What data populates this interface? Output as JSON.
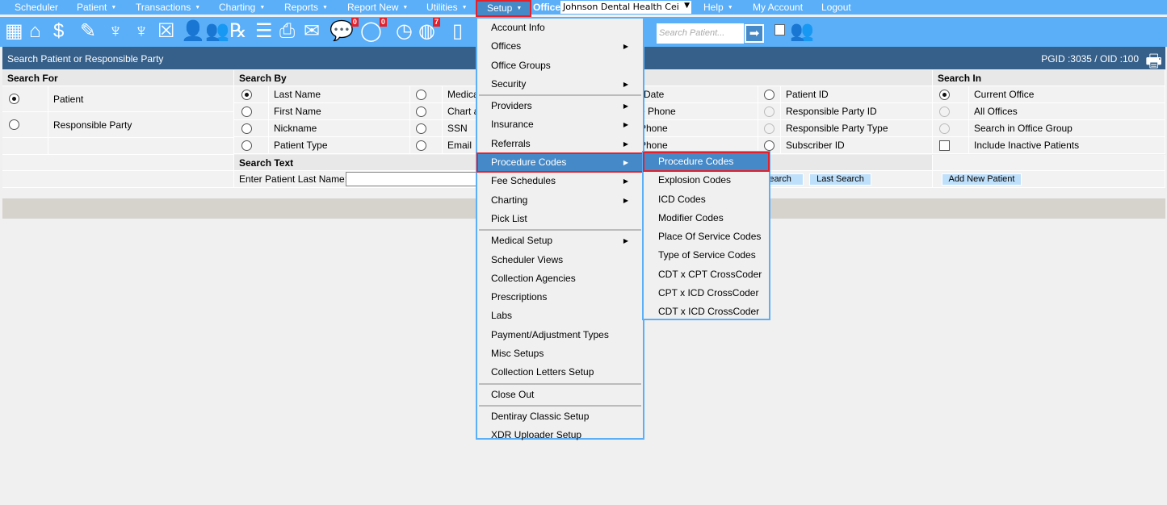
{
  "nav": {
    "items": [
      {
        "label": "Scheduler",
        "caret": false
      },
      {
        "label": "Patient",
        "caret": true
      },
      {
        "label": "Transactions",
        "caret": true
      },
      {
        "label": "Charting",
        "caret": true
      },
      {
        "label": "Reports",
        "caret": true
      },
      {
        "label": "Report New",
        "caret": true
      },
      {
        "label": "Utilities",
        "caret": true
      }
    ],
    "setup": "Setup",
    "office_label": "Office",
    "office_value": "Johnson Dental Health Cei",
    "help": "Help",
    "my_account": "My Account",
    "logout": "Logout"
  },
  "toolbar": {
    "icons": [
      "calendar-icon",
      "home-icon",
      "payment-icon",
      "notes-icon",
      "tooth-icon",
      "tooth-roots-icon",
      "treatment-icon",
      "add-patient-icon",
      "add-family-icon",
      "prescription-icon",
      "notepad-icon",
      "print-icon",
      "mail-icon",
      "messages-icon",
      "chat-icon",
      "clock-icon",
      "global-users-icon",
      "tooth-card-icon"
    ],
    "messages_badge": "0",
    "chat_badge": "0",
    "global_badge": "7",
    "search_placeholder": "Search Patient..."
  },
  "title": {
    "text": "Search Patient or Responsible Party",
    "ids": "PGID :3035  /  OID :100"
  },
  "search_for": {
    "header": "Search For",
    "options": [
      {
        "label": "Patient",
        "checked": true
      },
      {
        "label": "Responsible Party",
        "checked": false
      }
    ]
  },
  "search_by": {
    "header": "Search By",
    "col1": [
      {
        "label": "Last Name",
        "checked": true
      },
      {
        "label": "First Name"
      },
      {
        "label": "Nickname"
      },
      {
        "label": "Patient Type"
      }
    ],
    "col2": [
      {
        "label": "Medica"
      },
      {
        "label": "Chart a"
      },
      {
        "label": "SSN"
      },
      {
        "label": "Email"
      }
    ],
    "col3": [
      "Date",
      "e Phone",
      "Phone",
      "Phone"
    ],
    "col4": [
      {
        "label": "Patient ID",
        "disabled": false
      },
      {
        "label": "Responsible Party ID",
        "disabled": true
      },
      {
        "label": "Responsible Party Type",
        "disabled": true
      },
      {
        "label": "Subscriber ID",
        "disabled": false
      }
    ]
  },
  "search_in": {
    "header": "Search In",
    "options": [
      {
        "label": "Current Office",
        "checked": true,
        "disabled": false
      },
      {
        "label": "All Offices",
        "disabled": true
      },
      {
        "label": "Search in Office Group",
        "disabled": true
      }
    ],
    "inactive_label": "Include Inactive Patients",
    "inactive_checked": false
  },
  "search_text": {
    "header": "Search Text",
    "label": "Enter Patient Last Name:",
    "value": "",
    "search_btn": "Search",
    "last_search_btn": "Last Search",
    "add_patient_btn": "Add New Patient"
  },
  "setup_menu": [
    {
      "label": "Account Info"
    },
    {
      "label": "Offices",
      "sub": true
    },
    {
      "label": "Office Groups"
    },
    {
      "label": "Security",
      "sub": true
    },
    {
      "sep": true
    },
    {
      "label": "Providers",
      "sub": true
    },
    {
      "label": "Insurance",
      "sub": true
    },
    {
      "label": "Referrals",
      "sub": true
    },
    {
      "label": "Procedure Codes",
      "sub": true,
      "active": true
    },
    {
      "label": "Fee Schedules",
      "sub": true
    },
    {
      "label": "Charting",
      "sub": true
    },
    {
      "label": "Pick List"
    },
    {
      "sep": true
    },
    {
      "label": "Medical Setup",
      "sub": true
    },
    {
      "label": "Scheduler Views"
    },
    {
      "label": "Collection Agencies"
    },
    {
      "label": "Prescriptions"
    },
    {
      "label": "Labs"
    },
    {
      "label": "Payment/Adjustment Types"
    },
    {
      "label": "Misc Setups"
    },
    {
      "label": "Collection Letters Setup"
    },
    {
      "sep": true
    },
    {
      "label": "Close Out"
    },
    {
      "sep": true
    },
    {
      "label": "Dentiray Classic Setup"
    },
    {
      "label": "XDR Uploader Setup"
    }
  ],
  "procedure_submenu": [
    {
      "label": "Procedure Codes",
      "active": true
    },
    {
      "label": "Explosion Codes"
    },
    {
      "label": "ICD Codes"
    },
    {
      "label": "Modifier Codes"
    },
    {
      "label": "Place Of Service Codes"
    },
    {
      "label": "Type of Service Codes"
    },
    {
      "label": "CDT x CPT CrossCoder"
    },
    {
      "label": "CPT x ICD CrossCoder"
    },
    {
      "label": "CDT x ICD CrossCoder"
    }
  ],
  "colors": {
    "nav": "#5aaff8",
    "title": "#36608a",
    "highlight": "#4589c8",
    "outline": "#e5202a"
  }
}
